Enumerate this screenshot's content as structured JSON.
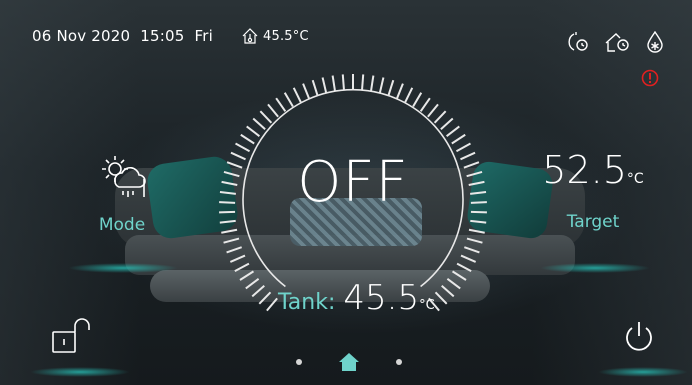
{
  "status_bar": {
    "date": "06 Nov 2020",
    "time": "15:05",
    "weekday": "Fri",
    "outdoor_temp": "45.5°C",
    "icons": [
      "home-temperature-icon",
      "timer-icon",
      "holiday-timer-icon",
      "antifreeze-icon"
    ],
    "alarm_icon": "alarm-icon",
    "alarm_color": "#e02020"
  },
  "main": {
    "status": "OFF",
    "tank_label": "Tank:",
    "tank_value": "45.5",
    "tank_unit": "°C"
  },
  "mode": {
    "label": "Mode",
    "icon": "weather-mode-icon"
  },
  "target": {
    "value": "52.5",
    "unit": "°C",
    "label": "Target"
  },
  "bottom": {
    "lock_icon": "unlock-icon",
    "power_icon": "power-icon",
    "pages": [
      "page-dot",
      "home-icon",
      "page-dot"
    ],
    "active_page": 1
  },
  "colors": {
    "accent": "#6fd3cb",
    "text": "#ffffff",
    "alarm": "#e02020"
  }
}
